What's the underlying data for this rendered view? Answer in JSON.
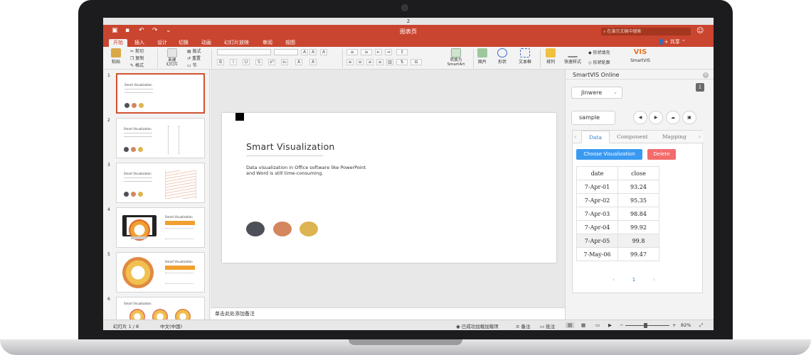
{
  "window": {
    "doc_name": "2",
    "app_title": "图表页"
  },
  "quick_access": {
    "search_placeholder": "在演示文稿中搜索"
  },
  "tabs": [
    "开始",
    "插入",
    "设计",
    "切换",
    "动画",
    "幻灯片放映",
    "审阅",
    "视图"
  ],
  "share_label": "共享",
  "ribbon": {
    "paste": "粘贴",
    "cut": "剪切",
    "copy": "复制",
    "format": "格式",
    "new_slide": "新建\n幻灯片",
    "layout": "版式",
    "reset": "重置",
    "section": "节",
    "convert_smartart": "转换为\nSmartArt",
    "picture": "图片",
    "shape": "形状",
    "textbox": "文本框",
    "arrange": "排列",
    "quick_styles": "快速样式",
    "shape_fill": "形状填充",
    "shape_outline": "形状轮廓",
    "smartvis": "SmartVIS",
    "bold": "B",
    "italic": "I",
    "underline": "U"
  },
  "slides": {
    "numbers": [
      "1",
      "2",
      "3",
      "4",
      "5",
      "6"
    ],
    "thumb_title": "Smart Visualization"
  },
  "main_slide": {
    "title": "Smart Visualization",
    "body": "Data visualization in Office software like PowerPoint and Word is still time-consuming.",
    "circle_colors": [
      "#4d5057",
      "#d4865e",
      "#ddb452"
    ]
  },
  "notes_placeholder": "单击此处添加备注",
  "taskpane": {
    "title": "SmartVIS Online",
    "account": "Jinwere",
    "info": "i",
    "dataset": "sample",
    "tabs": [
      "Data",
      "Component",
      "Mapping"
    ],
    "choose_button": "Choose Visualization",
    "delete_button": "Delete",
    "table": {
      "headers": [
        "date",
        "close"
      ],
      "rows": [
        [
          "7-Apr-01",
          "93.24"
        ],
        [
          "7-Apr-02",
          "95.35"
        ],
        [
          "7-Apr-03",
          "98.84"
        ],
        [
          "7-Apr-04",
          "99.92"
        ],
        [
          "7-Apr-05",
          "99.8"
        ],
        [
          "7-May-06",
          "99.47"
        ]
      ]
    },
    "page": "1"
  },
  "statusbar": {
    "slide_count": "幻灯片 1 / 8",
    "language": "中文(中国)",
    "addin_status": "已成功加载加载项",
    "notes": "备注",
    "comments": "批注",
    "zoom": "82%"
  },
  "colors": {
    "accent": "#c9452f",
    "primary_button": "#3a9af2",
    "danger_button": "#f46b6b"
  }
}
